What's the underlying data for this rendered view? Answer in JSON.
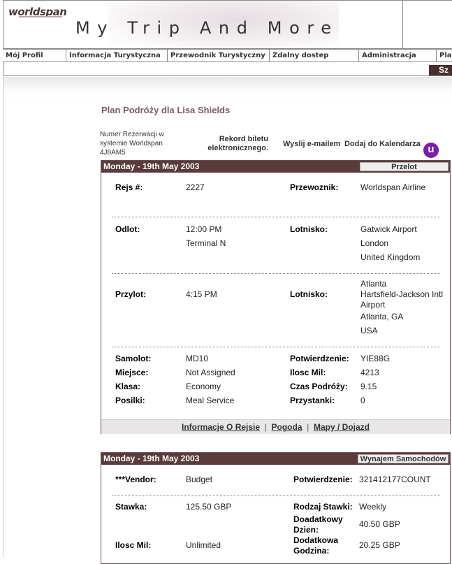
{
  "header": {
    "logo": "worldspan",
    "app_title": "My Trip And More"
  },
  "nav": {
    "items": [
      "Mój Profil",
      "Informacja Turystyczna",
      "Przewodnik Turystyczny",
      "Zdalny dostep",
      "Administracja",
      "Plan"
    ],
    "search_label": "Sz"
  },
  "itinerary": {
    "title": "Plan Podróży dla Lisa Shields",
    "record_label": "Numer Rezerwacji w systemie Worldspan 4J8AM5",
    "eticket_label": "Rekord biletu elektronicznego.",
    "email_link": "Wyslij e-mailem",
    "calendar_link": "Dodaj do Kalendarza",
    "calendar_icon_glyph": "u"
  },
  "flight": {
    "date": "Monday - 19th May 2003",
    "type": "Przelot",
    "flight_no_label": "Rejs #:",
    "flight_no": "2227",
    "carrier_label": "Przewoznik:",
    "carrier": "Worldspan Airline",
    "depart_label": "Odlot:",
    "depart_time": "12:00 PM",
    "depart_terminal": "Terminal N",
    "depart_airport_label": "Lotnisko:",
    "depart_airport": "Gatwick Airport",
    "depart_city": "London",
    "depart_country": "United Kingdom",
    "arrive_label": "Przylot:",
    "arrive_time": "4:15 PM",
    "arrive_airport_label": "Lotnisko:",
    "arrive_airport_1": "Atlanta",
    "arrive_airport_2": "Hartsfield-Jackson Intl",
    "arrive_airport_3": "Airport",
    "arrive_city": "Atlanta, GA",
    "arrive_country": "USA",
    "aircraft_label": "Samolot:",
    "aircraft": "MD10",
    "seat_label": "Miejsce:",
    "seat": "Not Assigned",
    "class_label": "Klasa:",
    "class": "Economy",
    "meals_label": "Posilki:",
    "meals": "Meal Service",
    "confirm_label": "Potwierdzenie:",
    "confirm": "YIE88G",
    "miles_label": "Ilosc Mil:",
    "miles": "4213",
    "duration_label": "Czas Podróży:",
    "duration": "9.15",
    "stops_label": "Przystanki:",
    "stops": "0",
    "footer_info": "Informacje O Rejsie",
    "footer_sep": "|",
    "footer_weather": "Pogoda",
    "footer_maps": "Mapy / Dojazd"
  },
  "car": {
    "date": "Monday - 19th May 2003",
    "type": "Wynajem Samochodów",
    "vendor_label": "***Vendor:",
    "vendor": "Budget",
    "confirm_label": "Potwierdzenie:",
    "confirm": "321412177COUNT",
    "rate_label": "Stawka:",
    "rate": "125.50 GBP",
    "rate_type_label": "Rodzaj Stawki:",
    "rate_type": "Weekly",
    "extra_day_label_1": "Doadatkowy",
    "extra_day_label_2": "Dzien:",
    "extra_day": "40.50 GBP",
    "miles_label": "Ilosc Mil:",
    "miles": "Unlimited",
    "extra_hour_label_1": "Dodatkowa",
    "extra_hour_label_2": "Godzina:",
    "extra_hour": "20.25 GBP"
  },
  "colors": {
    "bar": "#5a3a3a",
    "title": "#7a5a6a",
    "calendar_icon": "#7a1fa8"
  }
}
